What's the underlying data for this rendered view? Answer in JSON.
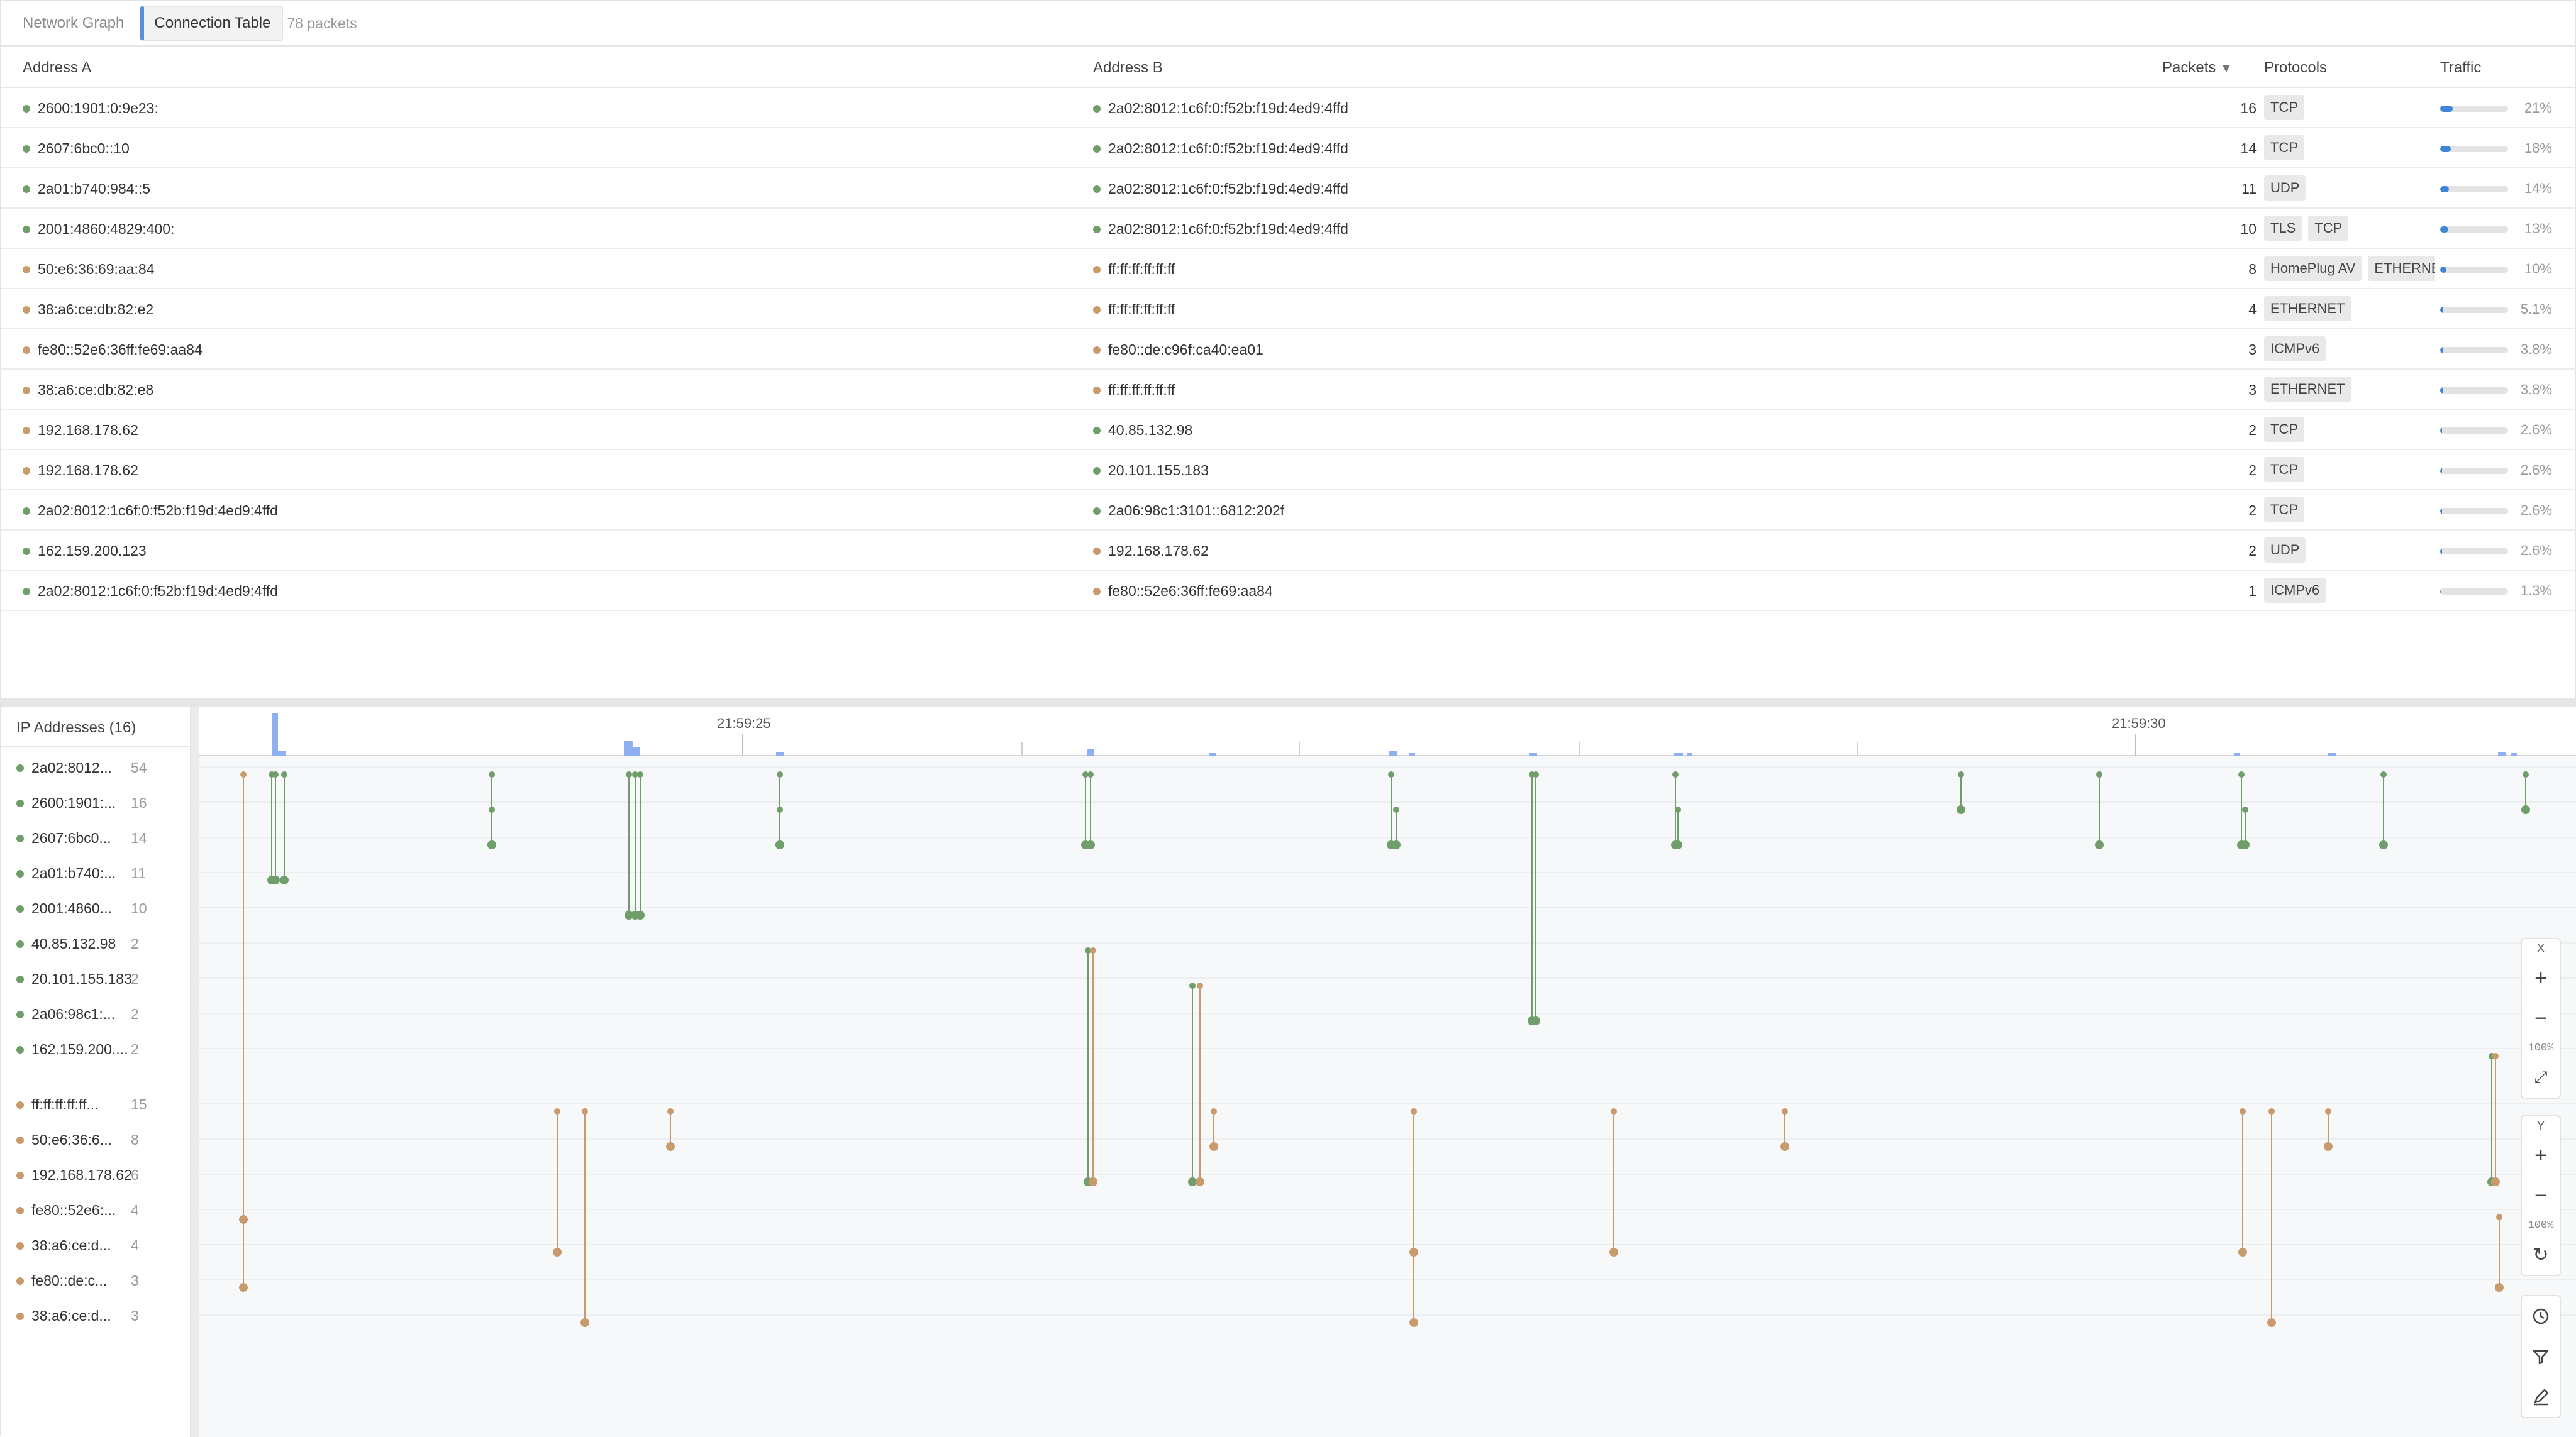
{
  "tabs": [
    {
      "label": "Network Graph",
      "active": false
    },
    {
      "label": "Connection Table",
      "active": true
    }
  ],
  "packet_count_label": "78 packets",
  "table": {
    "columns": {
      "a": "Address A",
      "b": "Address B",
      "packets": "Packets",
      "protocols": "Protocols",
      "traffic": "Traffic"
    },
    "sort_indicator": "▼",
    "rows": [
      {
        "a": "2600:1901:0:9e23:",
        "a_kind": "g",
        "b": "2a02:8012:1c6f:0:f52b:f19d:4ed9:4ffd",
        "b_kind": "g",
        "packets": "16",
        "protocols": [
          "TCP"
        ],
        "traffic": 0.21,
        "pct": "21%"
      },
      {
        "a": "2607:6bc0::10",
        "a_kind": "g",
        "b": "2a02:8012:1c6f:0:f52b:f19d:4ed9:4ffd",
        "b_kind": "g",
        "packets": "14",
        "protocols": [
          "TCP"
        ],
        "traffic": 0.18,
        "pct": "18%"
      },
      {
        "a": "2a01:b740:984::5",
        "a_kind": "g",
        "b": "2a02:8012:1c6f:0:f52b:f19d:4ed9:4ffd",
        "b_kind": "g",
        "packets": "11",
        "protocols": [
          "UDP"
        ],
        "traffic": 0.14,
        "pct": "14%"
      },
      {
        "a": "2001:4860:4829:400:",
        "a_kind": "g",
        "b": "2a02:8012:1c6f:0:f52b:f19d:4ed9:4ffd",
        "b_kind": "g",
        "packets": "10",
        "protocols": [
          "TLS",
          "TCP"
        ],
        "traffic": 0.13,
        "pct": "13%"
      },
      {
        "a": "50:e6:36:69:aa:84",
        "a_kind": "o",
        "b": "ff:ff:ff:ff:ff:ff",
        "b_kind": "o",
        "packets": "8",
        "protocols": [
          "HomePlug AV",
          "ETHERNET"
        ],
        "traffic": 0.1,
        "pct": "10%"
      },
      {
        "a": "38:a6:ce:db:82:e2",
        "a_kind": "o",
        "b": "ff:ff:ff:ff:ff:ff",
        "b_kind": "o",
        "packets": "4",
        "protocols": [
          "ETHERNET"
        ],
        "traffic": 0.051,
        "pct": "5.1%"
      },
      {
        "a": "fe80::52e6:36ff:fe69:aa84",
        "a_kind": "o",
        "b": "fe80::de:c96f:ca40:ea01",
        "b_kind": "o",
        "packets": "3",
        "protocols": [
          "ICMPv6"
        ],
        "traffic": 0.038,
        "pct": "3.8%"
      },
      {
        "a": "38:a6:ce:db:82:e8",
        "a_kind": "o",
        "b": "ff:ff:ff:ff:ff:ff",
        "b_kind": "o",
        "packets": "3",
        "protocols": [
          "ETHERNET"
        ],
        "traffic": 0.038,
        "pct": "3.8%"
      },
      {
        "a": "192.168.178.62",
        "a_kind": "o",
        "b": "40.85.132.98",
        "b_kind": "g",
        "packets": "2",
        "protocols": [
          "TCP"
        ],
        "traffic": 0.026,
        "pct": "2.6%"
      },
      {
        "a": "192.168.178.62",
        "a_kind": "o",
        "b": "20.101.155.183",
        "b_kind": "g",
        "packets": "2",
        "protocols": [
          "TCP"
        ],
        "traffic": 0.026,
        "pct": "2.6%"
      },
      {
        "a": "2a02:8012:1c6f:0:f52b:f19d:4ed9:4ffd",
        "a_kind": "g",
        "b": "2a06:98c1:3101::6812:202f",
        "b_kind": "g",
        "packets": "2",
        "protocols": [
          "TCP"
        ],
        "traffic": 0.026,
        "pct": "2.6%"
      },
      {
        "a": "162.159.200.123",
        "a_kind": "g",
        "b": "192.168.178.62",
        "b_kind": "o",
        "packets": "2",
        "protocols": [
          "UDP"
        ],
        "traffic": 0.026,
        "pct": "2.6%"
      },
      {
        "a": "2a02:8012:1c6f:0:f52b:f19d:4ed9:4ffd",
        "a_kind": "g",
        "b": "fe80::52e6:36ff:fe69:aa84",
        "b_kind": "o",
        "packets": "1",
        "protocols": [
          "ICMPv6"
        ],
        "traffic": 0.013,
        "pct": "1.3%"
      }
    ]
  },
  "ip_panel": {
    "title": "IP Addresses (16)",
    "items": [
      {
        "label": "2a02:8012...",
        "count": "54",
        "kind": "g"
      },
      {
        "label": "2600:1901:...",
        "count": "16",
        "kind": "g"
      },
      {
        "label": "2607:6bc0...",
        "count": "14",
        "kind": "g"
      },
      {
        "label": "2a01:b740:...",
        "count": "11",
        "kind": "g"
      },
      {
        "label": "2001:4860...",
        "count": "10",
        "kind": "g"
      },
      {
        "label": "40.85.132.98",
        "count": "2",
        "kind": "g"
      },
      {
        "label": "20.101.155.183",
        "count": "2",
        "kind": "g"
      },
      {
        "label": "2a06:98c1:...",
        "count": "2",
        "kind": "g"
      },
      {
        "label": "162.159.200....",
        "count": "2",
        "kind": "g"
      },
      {
        "label": "ff:ff:ff:ff:ff...",
        "count": "15",
        "kind": "o"
      },
      {
        "label": "50:e6:36:6...",
        "count": "8",
        "kind": "o"
      },
      {
        "label": "192.168.178.62",
        "count": "6",
        "kind": "o"
      },
      {
        "label": "fe80::52e6:...",
        "count": "4",
        "kind": "o"
      },
      {
        "label": "38:a6:ce:d...",
        "count": "4",
        "kind": "o"
      },
      {
        "label": "fe80::de:c...",
        "count": "3",
        "kind": "o"
      },
      {
        "label": "38:a6:ce:d...",
        "count": "3",
        "kind": "o"
      }
    ]
  },
  "timeline": {
    "time_labels": [
      "21:59:25",
      "21:59:30"
    ],
    "colors": {
      "green": "#6f9e6a",
      "orange": "#c99a6c",
      "histogram": "#8eb0f0"
    }
  },
  "controls": {
    "x_label": "X",
    "y_label": "Y",
    "x_zoom": "100%",
    "y_zoom": "100%",
    "icons": [
      "zoom-in-x-icon",
      "zoom-out-x-icon",
      "fit-icon",
      "zoom-in-y-icon",
      "zoom-out-y-icon",
      "reset-icon",
      "clock-icon",
      "filter-icon",
      "annotate-icon"
    ]
  }
}
